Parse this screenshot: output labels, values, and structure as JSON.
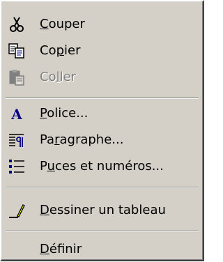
{
  "menu": {
    "items": [
      {
        "label_pre": "",
        "accel": "C",
        "label_post": "ouper",
        "icon": "scissors-icon",
        "enabled": true
      },
      {
        "label_pre": "Co",
        "accel": "p",
        "label_post": "ier",
        "icon": "copy-icon",
        "enabled": true
      },
      {
        "label_pre": "Co",
        "accel": "l",
        "label_post": "ler",
        "icon": "paste-icon",
        "enabled": false
      },
      {
        "label_pre": "",
        "accel": "P",
        "label_post": "olice...",
        "icon": "font-icon",
        "enabled": true
      },
      {
        "label_pre": "Pa",
        "accel": "r",
        "label_post": "agraphe...",
        "icon": "paragraph-icon",
        "enabled": true
      },
      {
        "label_pre": "P",
        "accel": "u",
        "label_post": "ces et numéros...",
        "icon": "bullets-icon",
        "enabled": true
      },
      {
        "label_pre": "",
        "accel": "D",
        "label_post": "essiner un tableau",
        "icon": "draw-table-icon",
        "enabled": true
      },
      {
        "label_pre": "",
        "accel": "D",
        "label_post": "éfinir",
        "icon": "",
        "enabled": true
      }
    ]
  },
  "colors": {
    "menu_bg": "#d4d0c8",
    "disabled_text": "#808080",
    "icon_blue": "#000080",
    "icon_yellow": "#ffff00"
  }
}
